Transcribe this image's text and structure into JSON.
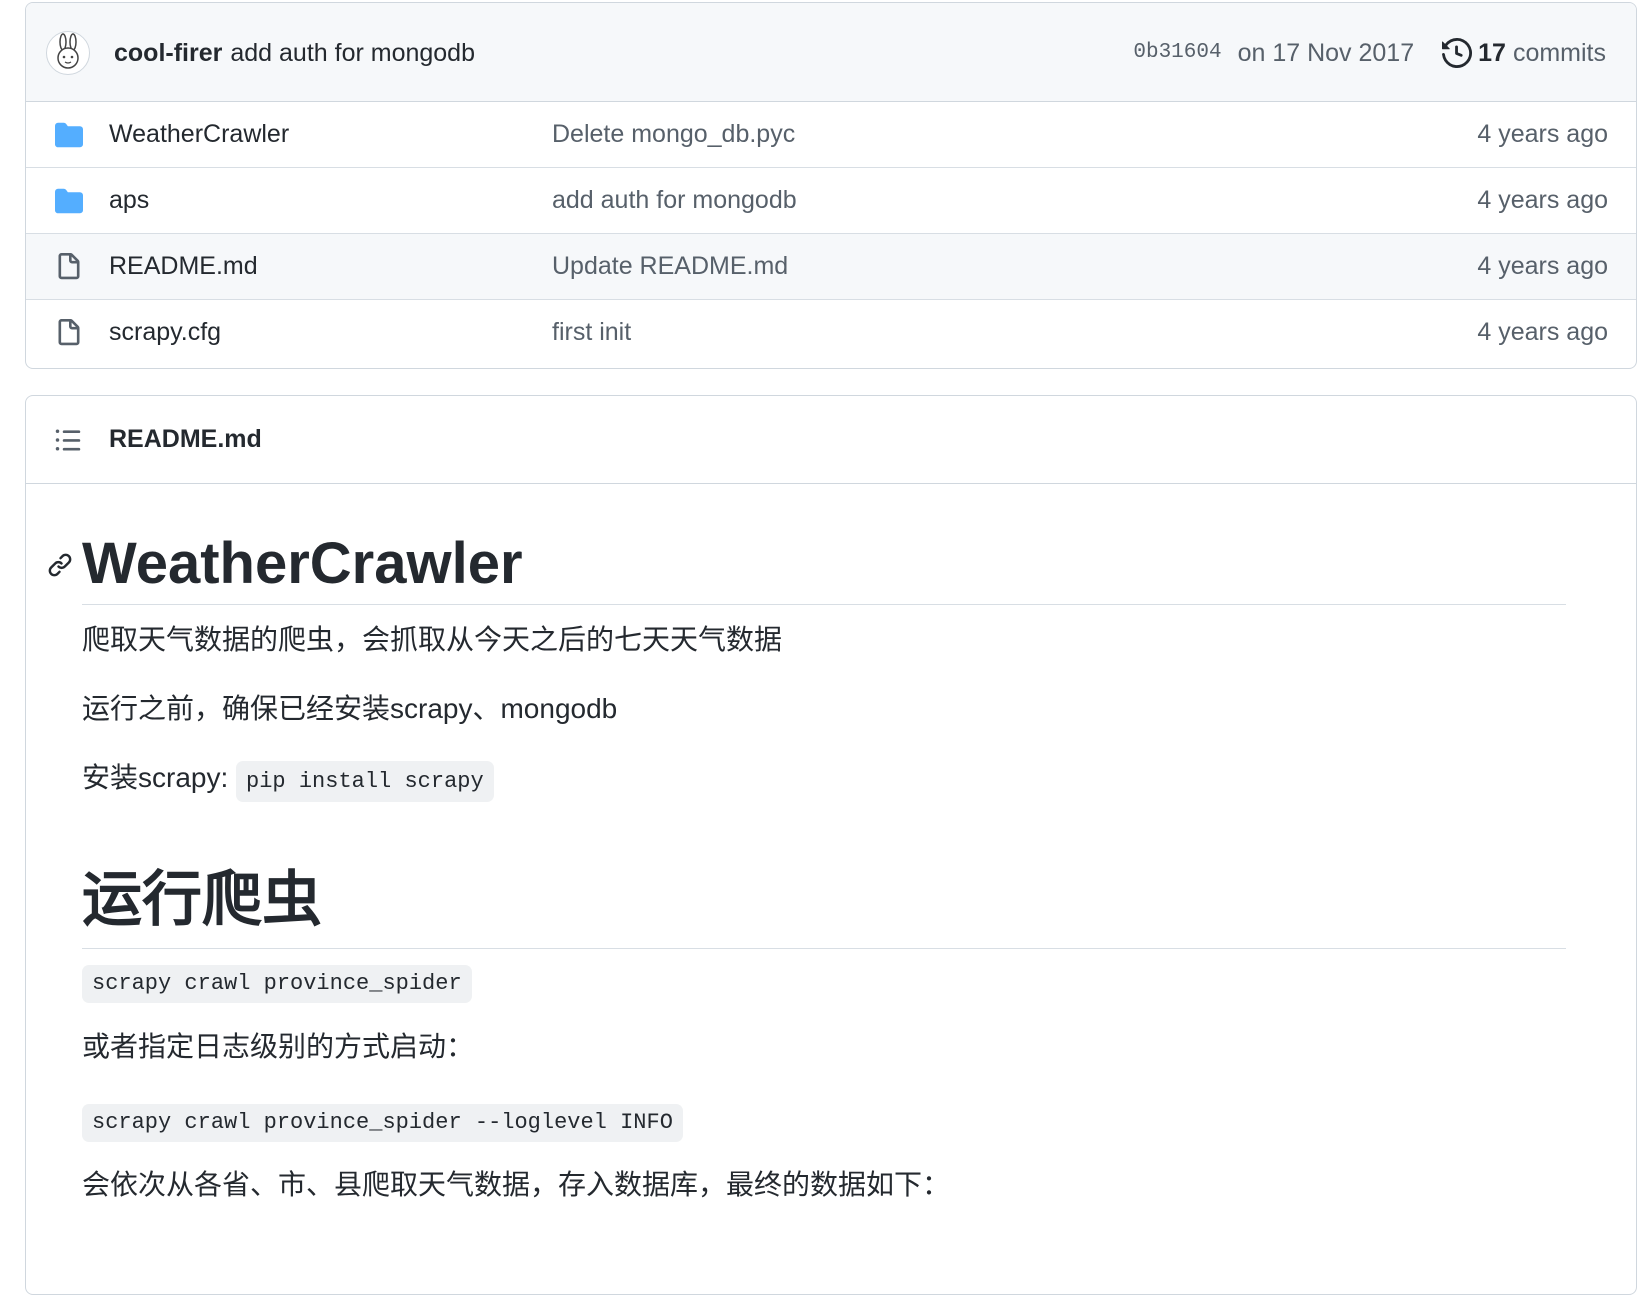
{
  "commit": {
    "author": "cool-firer",
    "message": "add auth for mongodb",
    "sha": "0b31604",
    "date": "on 17 Nov 2017",
    "commit_count": "17",
    "commit_word": "commits"
  },
  "files": [
    {
      "name": "WeatherCrawler",
      "type": "folder",
      "message": "Delete mongo_db.pyc",
      "age": "4 years ago"
    },
    {
      "name": "aps",
      "type": "folder",
      "message": "add auth for mongodb",
      "age": "4 years ago"
    },
    {
      "name": "README.md",
      "type": "file",
      "message": "Update README.md",
      "age": "4 years ago"
    },
    {
      "name": "scrapy.cfg",
      "type": "file",
      "message": "first init",
      "age": "4 years ago"
    }
  ],
  "readme": {
    "filename": "README.md",
    "h1": "WeatherCrawler",
    "p1": "爬取天气数据的爬虫，会抓取从今天之后的七天天气数据",
    "p2": "运行之前，确保已经安装scrapy、mongodb",
    "p3_prefix": "安装scrapy: ",
    "p3_code": "pip install scrapy",
    "h2": "运行爬虫",
    "code1": "scrapy crawl province_spider",
    "p4": "或者指定日志级别的方式启动：",
    "code2": "scrapy crawl province_spider --loglevel INFO",
    "p5": "会依次从各省、市、县爬取天气数据，存入数据库，最终的数据如下："
  },
  "colors": {
    "folder": "#54aeff",
    "file": "#57606a",
    "border": "#d0d7de",
    "code_bg": "#eff1f3"
  }
}
